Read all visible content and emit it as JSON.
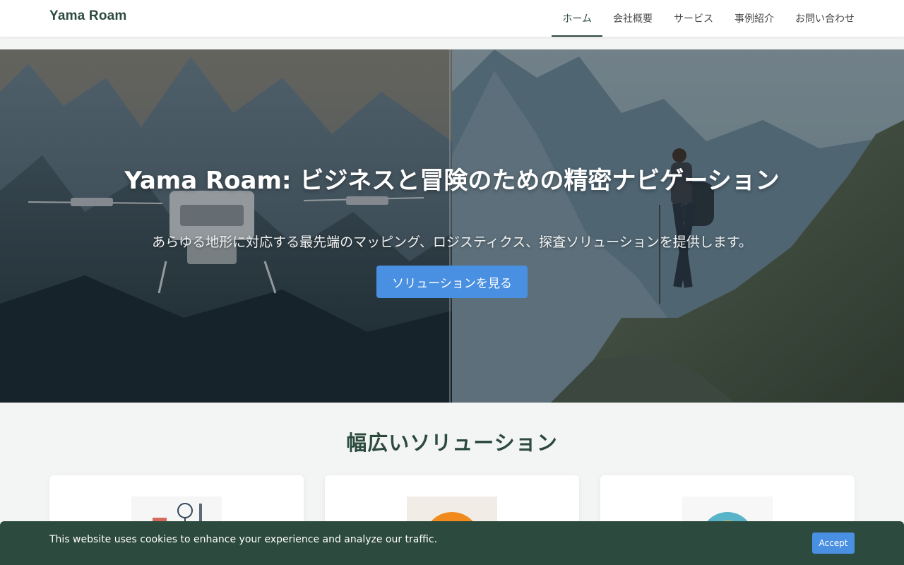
{
  "header": {
    "logo": "Yama Roam",
    "nav": [
      {
        "label": "ホーム",
        "active": true
      },
      {
        "label": "会社概要",
        "active": false
      },
      {
        "label": "サービス",
        "active": false
      },
      {
        "label": "事例紹介",
        "active": false
      },
      {
        "label": "お問い合わせ",
        "active": false
      }
    ]
  },
  "hero": {
    "title": "Yama Roam: ビジネスと冒険のための精密ナビゲーション",
    "subtitle": "あらゆる地形に対応する最先端のマッピング、ロジスティクス、探査ソリューションを提供します。",
    "cta_label": "ソリューションを見る",
    "image_left": "drone-over-mountains",
    "image_right": "hiker-on-mountain-ridge"
  },
  "solutions": {
    "title": "幅広いソリューション",
    "cards": [
      {
        "image": "card-illustration-1"
      },
      {
        "image": "card-illustration-2"
      },
      {
        "image": "card-illustration-3"
      }
    ]
  },
  "cookie": {
    "text": "This website uses cookies to enhance your experience and analyze our traffic.",
    "accept_label": "Accept"
  },
  "colors": {
    "brand": "#2d4a3e",
    "accent": "#4a90e2",
    "background": "#f3f5f4"
  }
}
